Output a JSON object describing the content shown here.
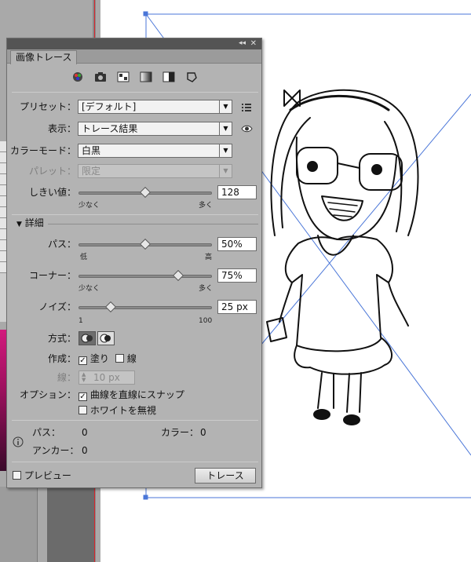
{
  "panel": {
    "tab_label": "画像トレース",
    "collapse_glyph": "◂◂",
    "close_glyph": "✕",
    "preset_icons": [
      "auto-color-icon",
      "high-color-icon",
      "low-color-icon",
      "grayscale-icon",
      "black-and-white-icon",
      "outline-icon"
    ]
  },
  "preset": {
    "label": "プリセット：",
    "value": "[デフォルト]"
  },
  "view": {
    "label": "表示：",
    "value": "トレース結果"
  },
  "color_mode": {
    "label": "カラーモード：",
    "value": "白黒"
  },
  "palette": {
    "label": "パレット：",
    "value": "限定"
  },
  "threshold": {
    "label": "しきい値：",
    "value": "128",
    "min_label": "少なく",
    "max_label": "多く",
    "level": 0.5
  },
  "advanced": {
    "label": "詳細"
  },
  "paths": {
    "label": "パス：",
    "value": "50%",
    "min_label": "低",
    "max_label": "高",
    "level": 0.5
  },
  "corners": {
    "label": "コーナー：",
    "value": "75%",
    "min_label": "少なく",
    "max_label": "多く",
    "level": 0.75
  },
  "noise": {
    "label": "ノイズ：",
    "value": "25 px",
    "min_label": "1",
    "max_label": "100",
    "level": 0.24
  },
  "method": {
    "label": "方式："
  },
  "create": {
    "label": "作成：",
    "fills": "塗り",
    "fills_checked": true,
    "strokes": "線",
    "strokes_checked": false
  },
  "stroke": {
    "label": "線：",
    "value": "10 px"
  },
  "options": {
    "label": "オプション：",
    "snap": "曲線を直線にスナップ",
    "snap_checked": true,
    "ignore_white": "ホワイトを無視",
    "ignore_white_checked": false
  },
  "info": {
    "paths_label": "パス：",
    "paths_value": "0",
    "colors_label": "カラー：",
    "colors_value": "0",
    "anchors_label": "アンカー：",
    "anchors_value": "0"
  },
  "preview": {
    "label": "プレビュー",
    "checked": false
  },
  "trace_button": {
    "label": "トレース"
  },
  "colors": {
    "artboard_line": "#4a76d8",
    "panel_bg": "#b3b3b3",
    "workspace": "#5c5c5c"
  }
}
